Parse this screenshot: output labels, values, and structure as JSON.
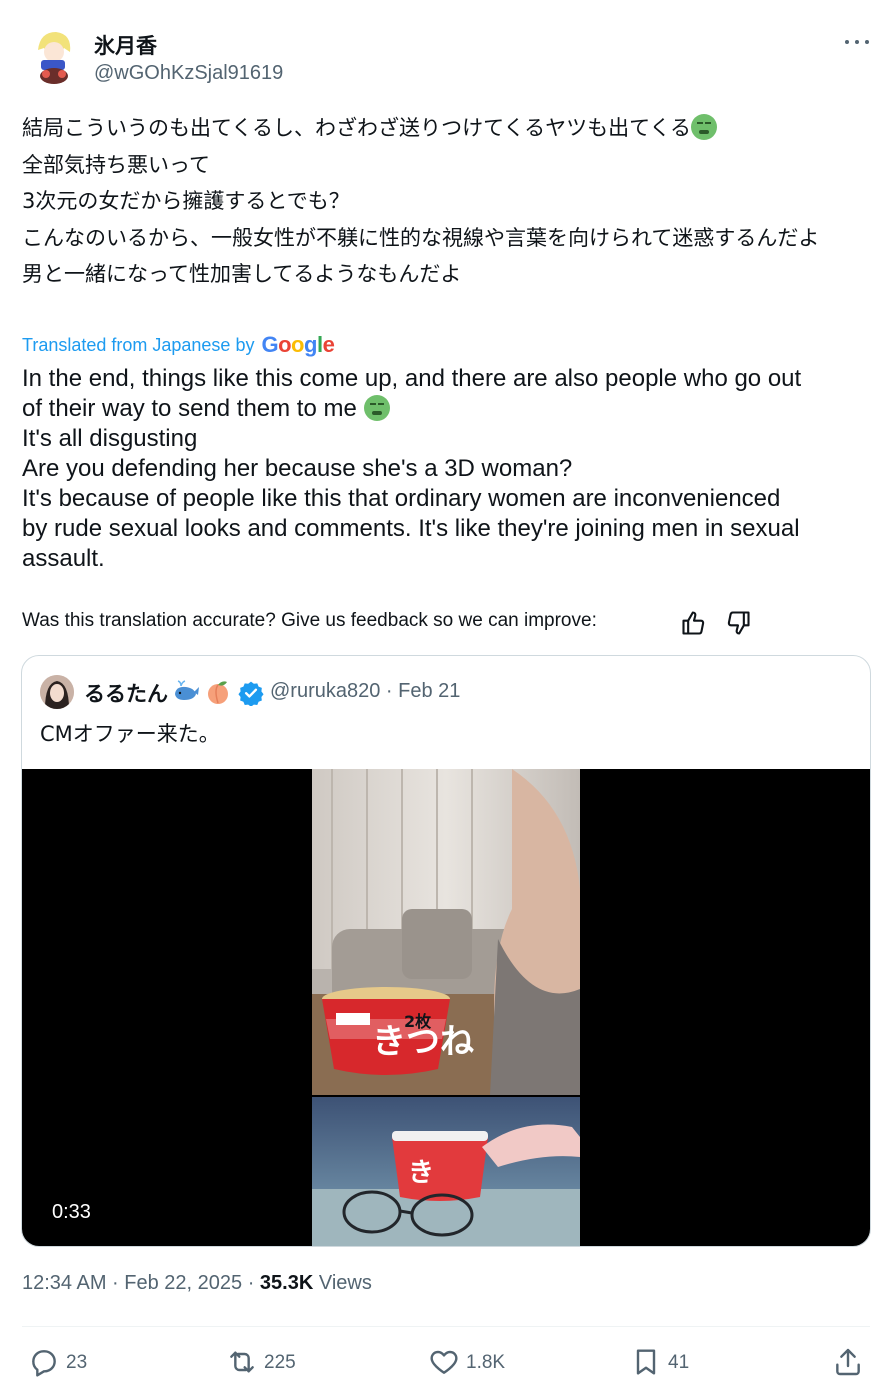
{
  "author": {
    "name": "氷月香",
    "handle": "@wGOhKzSjal91619",
    "avatar_icon": "anime-avatar-icon"
  },
  "tweet": {
    "original_lines": [
      "結局こういうのも出てくるし、わざわざ送りつけてくるヤツも出てくる",
      "全部気持ち悪いって",
      "3次元の女だから擁護するとでも？",
      "こんなのいるから、一般女性が不躾に性的な視線や言葉を向けられて迷惑するんだよ",
      "男と一緒になって性加害してるようなもんだよ"
    ],
    "translated_by_label": "Translated from Japanese by",
    "translator": "Google",
    "translation_lines": [
      "In the end, things like this come up, and there are also people who go out",
      "of their way to send them to me",
      "It's all disgusting",
      "Are you defending her because she's a 3D woman?",
      "It's because of people like this that ordinary women are inconvenienced",
      "by rude sexual looks and comments. It's like they're joining men in sexual",
      "assault."
    ],
    "feedback_prompt": "Was this translation accurate? Give us feedback so we can improve:"
  },
  "quoted": {
    "name": "るるたん",
    "handle_date": "@ruruka820 · Feb 21",
    "text": "CMオファー来た。",
    "video_duration": "0:33",
    "emojis": [
      "whale-icon",
      "peach-icon"
    ]
  },
  "meta": {
    "time_date": "12:34 AM · Feb 22, 2025 · ",
    "views_count": "35.3K",
    "views_label": " Views"
  },
  "actions": {
    "replies": "23",
    "retweets": "225",
    "likes": "1.8K",
    "bookmarks": "41"
  },
  "colors": {
    "link": "#1d9bf0",
    "secondary_text": "#536471",
    "border": "#cfd9de",
    "verified": "#1d9bf0"
  }
}
